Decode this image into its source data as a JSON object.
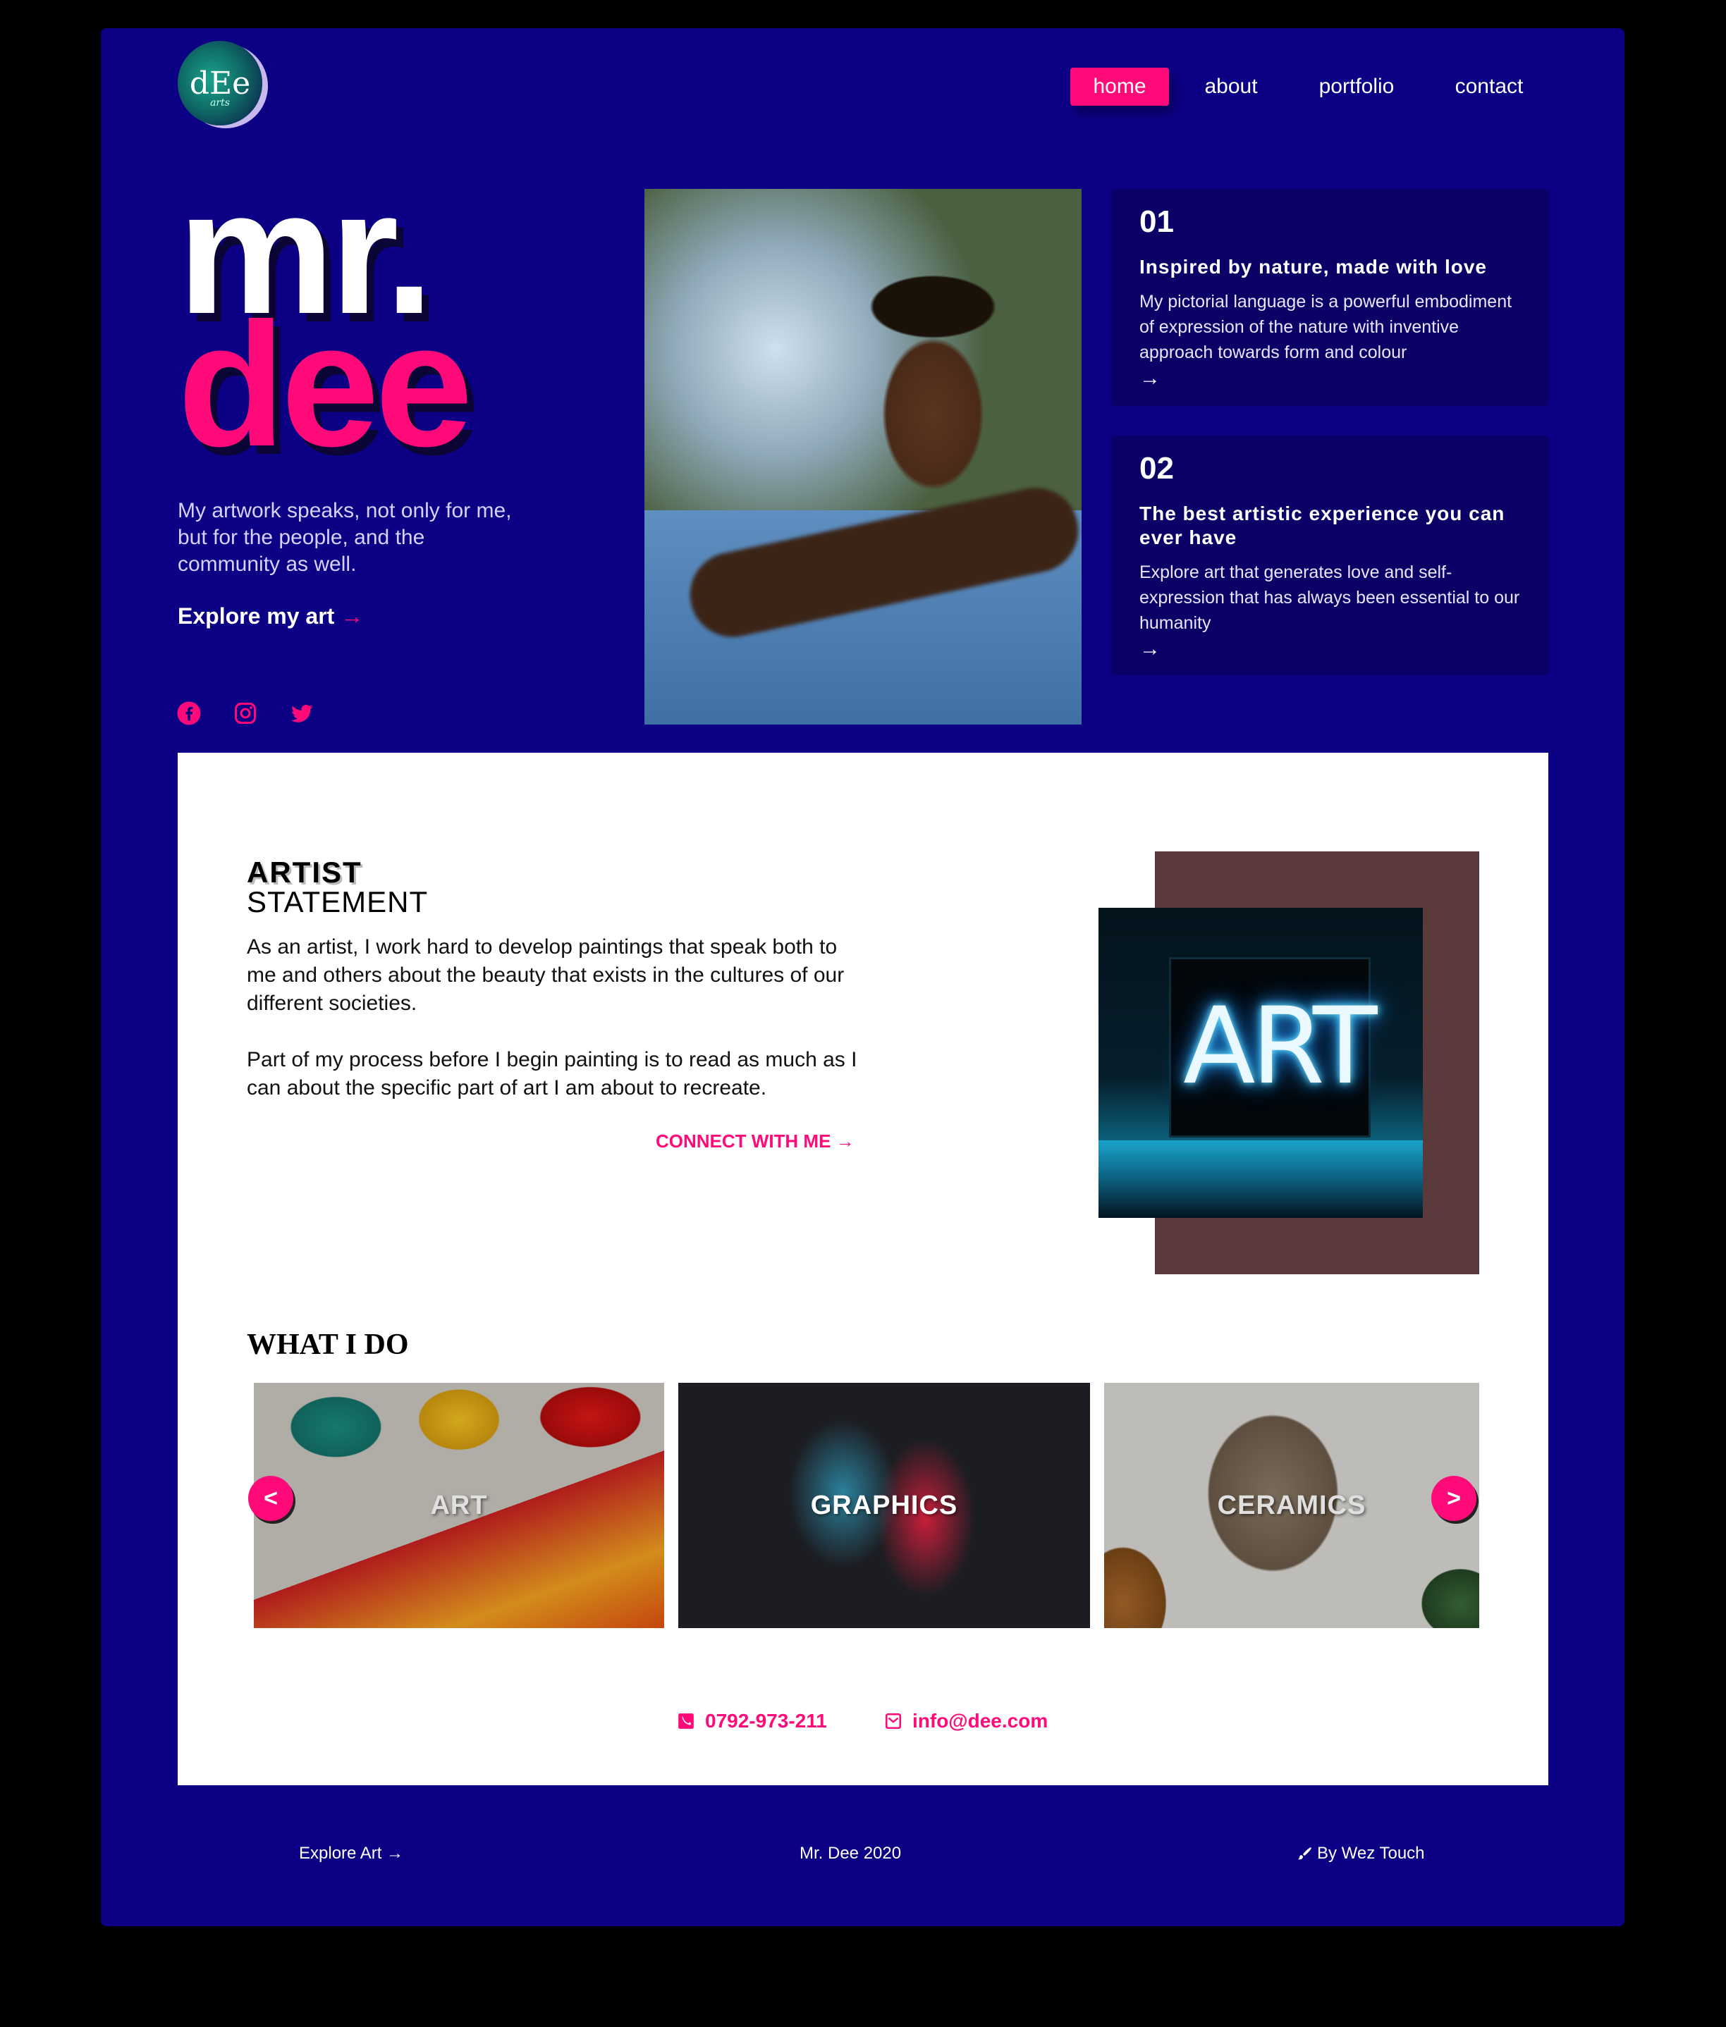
{
  "nav": {
    "items": [
      {
        "label": "home",
        "active": true
      },
      {
        "label": "about",
        "active": false
      },
      {
        "label": "portfolio",
        "active": false
      },
      {
        "label": "contact",
        "active": false
      }
    ]
  },
  "logo": {
    "text": "dEe",
    "sub": "arts"
  },
  "hero": {
    "line1": "mr.",
    "line2": "dee",
    "tagline": "My artwork speaks, not only for me, but for the people, and the community as well.",
    "cta": "Explore my art",
    "cta_arrow": "→"
  },
  "social": {
    "icons": [
      "facebook-icon",
      "instagram-icon",
      "twitter-icon"
    ]
  },
  "features": [
    {
      "num": "01",
      "title": "Inspired by nature, made with love",
      "desc": "My pictorial language is a powerful embodiment of expression of the nature with inventive approach towards form and colour",
      "arrow": "→"
    },
    {
      "num": "02",
      "title": "The best artistic experience you can ever have",
      "desc": "Explore art that generates love and self-expression that has always been essential to our humanity",
      "arrow": "→"
    }
  ],
  "statement": {
    "heading1": "ARTIST",
    "heading2": "STATEMENT",
    "para1": "As an artist, I work hard to develop paintings that speak both to me and others about the beauty that exists in the cultures of our different societies.",
    "para2": "Part of my process before I begin painting is to read as much as I can about the specific part of art I am about to recreate.",
    "cta": "CONNECT WITH ME →",
    "neon_text": "ART"
  },
  "what_i_do": {
    "heading": "WHAT I DO",
    "tiles": [
      {
        "label": "ART"
      },
      {
        "label": "GRAPHICS"
      },
      {
        "label": "CERAMICS"
      }
    ],
    "prev": "<",
    "next": ">"
  },
  "contact": {
    "phone": "0792-973-211",
    "email": "info@dee.com"
  },
  "footer": {
    "explore": "Explore Art →",
    "copyright": "Mr. Dee 2020",
    "credit": "By Wez Touch"
  },
  "colors": {
    "background": "#0c0085",
    "accent": "#ff0a78",
    "card": "#0a0065",
    "panel": "#ffffff"
  }
}
